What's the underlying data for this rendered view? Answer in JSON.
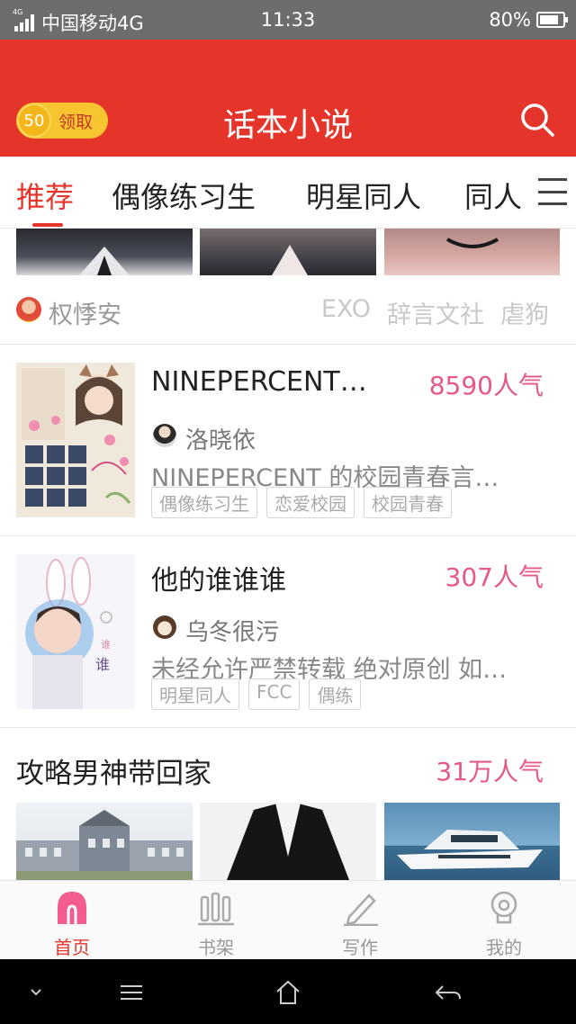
{
  "status_bar": {
    "network_type": "4G",
    "carrier": "中国移动4G",
    "time": "11:33",
    "battery": "80%"
  },
  "header": {
    "coin_amount": "50",
    "claim_label": "领取",
    "title": "话本小说",
    "search_icon": "search-icon"
  },
  "tabs": [
    {
      "label": "推荐",
      "active": true
    },
    {
      "label": "偶像练习生",
      "active": false
    },
    {
      "label": "明星同人",
      "active": false
    },
    {
      "label": "同人",
      "active": false
    }
  ],
  "top_card": {
    "author": "权悸安",
    "tags": [
      "EXO",
      "辞言文社",
      "虐狗"
    ]
  },
  "books": [
    {
      "title": "NINEPERCENT…",
      "popularity": "8590人气",
      "author": "洛晓依",
      "description": "NINEPERCENT 的校园青春言…",
      "tags": [
        "偶像练习生",
        "恋爱校园",
        "校园青春"
      ]
    },
    {
      "title": "他的谁谁谁",
      "popularity": "307人气",
      "author": "乌冬很污",
      "description": "未经允许严禁转载 绝对原创 如…",
      "tags": [
        "明星同人",
        "FCC",
        "偶练"
      ]
    }
  ],
  "section2": {
    "title": "攻略男神带回家",
    "popularity": "31万人气"
  },
  "bottom_nav": [
    {
      "label": "首页",
      "icon": "home-icon",
      "active": true
    },
    {
      "label": "书架",
      "icon": "bookshelf-icon",
      "active": false
    },
    {
      "label": "写作",
      "icon": "pen-icon",
      "active": false
    },
    {
      "label": "我的",
      "icon": "profile-icon",
      "active": false
    }
  ],
  "colors": {
    "brand": "#e5352b",
    "popularity": "#e6588a",
    "coin": "#f7c52f"
  }
}
